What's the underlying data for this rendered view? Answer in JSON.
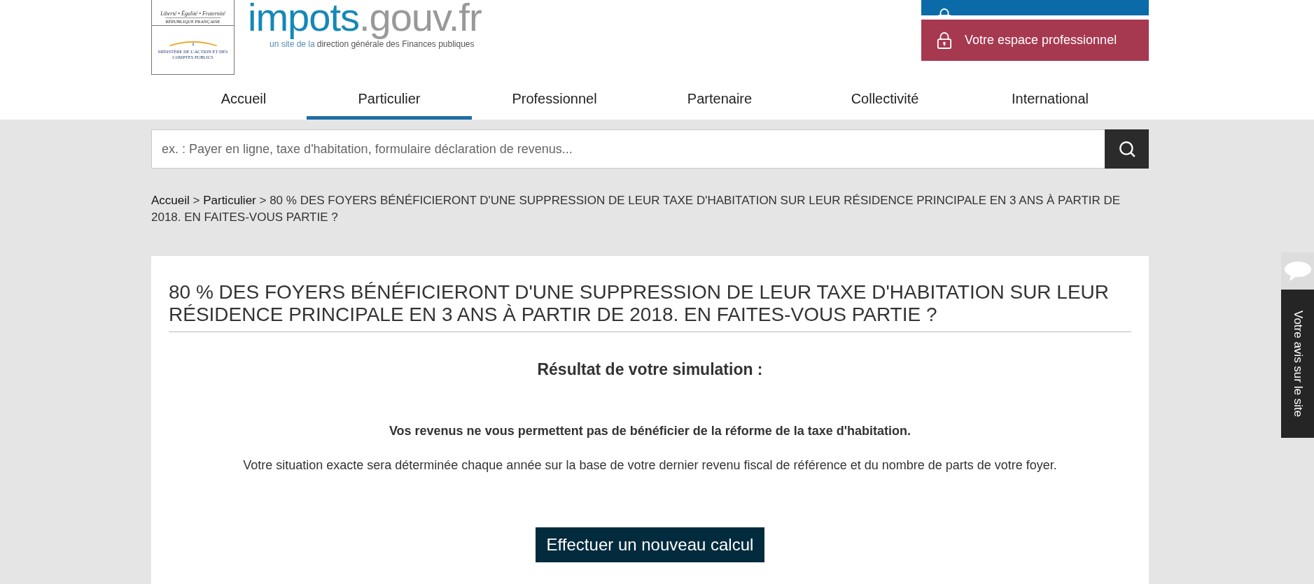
{
  "header": {
    "republic_logo": {
      "motto": "Liberté • Égalité • Fraternité",
      "country": "RÉPUBLIQUE FRANÇAISE",
      "ministry": "MINISTÈRE DE L'ACTION ET DES COMPTES PUBLICS"
    },
    "site_logo": {
      "name_main": "impots",
      "name_domain": ".gouv.fr",
      "tagline_lead": "un site de la",
      "tagline_rest": "direction générale des Finances publiques"
    },
    "account_buttons": [
      {
        "color": "#0b6ba8"
      },
      {
        "label": "Votre espace professionnel",
        "color": "#a6384f"
      }
    ]
  },
  "nav": [
    {
      "label": "Accueil",
      "selected": false
    },
    {
      "label": "Particulier",
      "selected": true
    },
    {
      "label": "Professionnel",
      "selected": false
    },
    {
      "label": "Partenaire",
      "selected": false
    },
    {
      "label": "Collectivité",
      "selected": false
    },
    {
      "label": "International",
      "selected": false
    }
  ],
  "search": {
    "placeholder": "ex. : Payer en ligne, taxe d'habitation, formulaire déclaration de revenus..."
  },
  "breadcrumb": {
    "separator": ">",
    "links": [
      "Accueil",
      "Particulier"
    ],
    "current": "80 % DES FOYERS BÉNÉFICIERONT D'UNE SUPPRESSION DE LEUR TAXE D'HABITATION SUR LEUR RÉSIDENCE PRINCIPALE EN 3 ANS À PARTIR DE 2018. EN FAITES-VOUS PARTIE ?"
  },
  "article": {
    "title": "80 % DES FOYERS BÉNÉFICIERONT D'UNE SUPPRESSION DE LEUR TAXE D'HABITATION SUR LEUR RÉSIDENCE PRINCIPALE EN 3 ANS À PARTIR DE 2018. EN FAITES-VOUS PARTIE ?",
    "result_heading": "Résultat de votre simulation :",
    "message": "Vos revenus ne vous permettent pas de bénéficier de la réforme de la taxe d'habitation.",
    "note": "Votre situation exacte sera déterminée chaque année sur la base de votre dernier revenu fiscal de référence et du nombre de parts de votre foyer.",
    "button": "Effectuer un nouveau calcul"
  },
  "feedback_tab": {
    "label": "Votre avis sur le site"
  }
}
